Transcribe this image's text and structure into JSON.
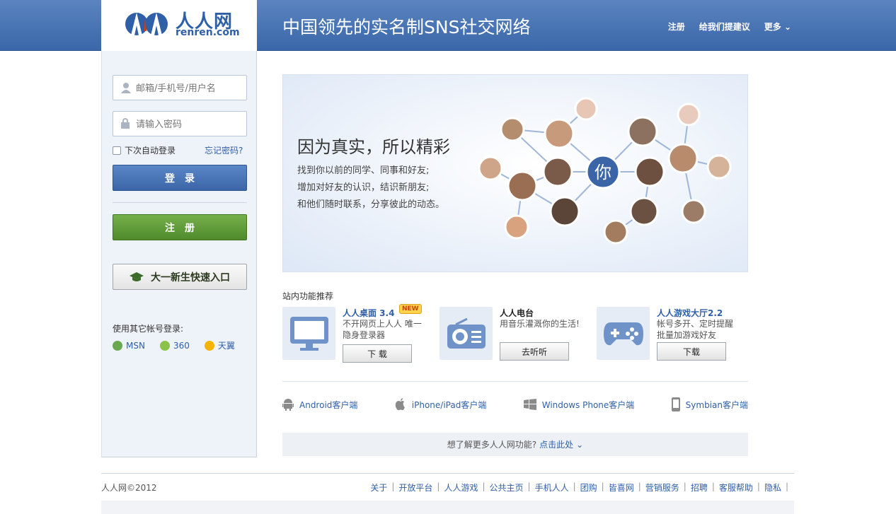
{
  "header": {
    "logo_cn": "人人网",
    "logo_en": "renren.com",
    "slogan": "中国领先的实名制SNS社交网络",
    "nav": [
      "注册",
      "给我们提建议",
      "更多"
    ]
  },
  "login": {
    "username_placeholder": "邮箱/手机号/用户名",
    "password_placeholder": "请输入密码",
    "remember_label": "下次自动登录",
    "forgot_label": "忘记密码?",
    "login_button": "登录",
    "register_button": "注册",
    "freshman_button": "大一新生快速入口",
    "other_label": "使用其它帐号登录:",
    "other_accounts": [
      {
        "label": "MSN",
        "icon": "msn-icon",
        "color": "#6aa84f"
      },
      {
        "label": "360",
        "icon": "360-icon",
        "color": "#8bc34a"
      },
      {
        "label": "天翼",
        "icon": "tianyi-icon",
        "color": "#f4b400"
      }
    ]
  },
  "hero": {
    "title": "因为真实，所以精彩",
    "lines": [
      "找到你以前的同学、同事和好友;",
      "增加对好友的认识，结识新朋友;",
      "和他们随时联系，分享彼此的动态。"
    ],
    "center_label": "你"
  },
  "features": {
    "section_title": "站内功能推荐",
    "items": [
      {
        "name": "人人桌面 3.4",
        "badge": "NEW",
        "desc": "不开网页上人人 唯一隐身登录器",
        "button": "下 载",
        "icon": "monitor-icon"
      },
      {
        "name": "人人电台",
        "desc": "用音乐灌溉你的生活!",
        "button": "去听听",
        "icon": "radio-icon"
      },
      {
        "name": "人人游戏大厅2.2",
        "desc": "帐号多开、定时提醒 批量加游戏好友",
        "button": "下载",
        "icon": "gamepad-icon"
      }
    ]
  },
  "clients": [
    {
      "label": "Android客户端",
      "icon": "android-icon"
    },
    {
      "label": "iPhone/iPad客户端",
      "icon": "apple-icon"
    },
    {
      "label": "Windows Phone客户端",
      "icon": "windows-icon"
    },
    {
      "label": "Symbian客户端",
      "icon": "phone-icon"
    }
  ],
  "more": {
    "text": "想了解更多人人网功能?",
    "link": "点击此处"
  },
  "footer": {
    "copyright": "人人网©2012",
    "links": [
      "关于",
      "开放平台",
      "人人游戏",
      "公共主页",
      "手机人人",
      "团购",
      "皆喜网",
      "营销服务",
      "招聘",
      "客服帮助",
      "隐私"
    ]
  },
  "colors": {
    "brand_blue": "#2f5fa7",
    "login_blue": "#3b65a7",
    "register_green": "#4f8a2c"
  }
}
